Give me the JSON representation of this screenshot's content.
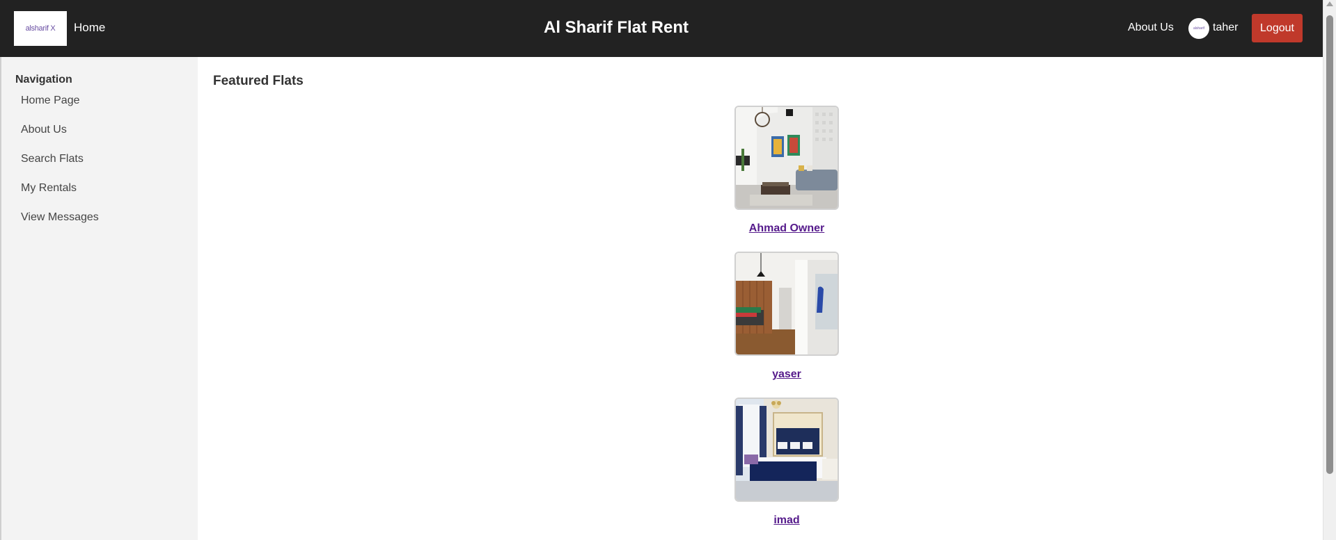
{
  "header": {
    "logo_text": "alsharif X",
    "home_label": "Home",
    "title": "Al Sharif Flat Rent",
    "about_label": "About Us",
    "avatar_text": "alsharif",
    "username": "taher",
    "logout_label": "Logout"
  },
  "sidebar": {
    "heading": "Navigation",
    "items": [
      {
        "label": "Home Page"
      },
      {
        "label": "About Us"
      },
      {
        "label": "Search Flats"
      },
      {
        "label": "My Rentals"
      },
      {
        "label": "View Messages"
      }
    ]
  },
  "main": {
    "section_title": "Featured Flats",
    "flats": [
      {
        "owner": "Ahmad Owner",
        "image": "living-room-photo"
      },
      {
        "owner": "yaser",
        "image": "bedroom-wood-photo"
      },
      {
        "owner": "imad",
        "image": "bedroom-blue-photo"
      }
    ]
  },
  "colors": {
    "header_bg": "#222222",
    "sidebar_bg": "#f3f3f3",
    "logout_bg": "#c0392b",
    "link": "#551a8b"
  }
}
